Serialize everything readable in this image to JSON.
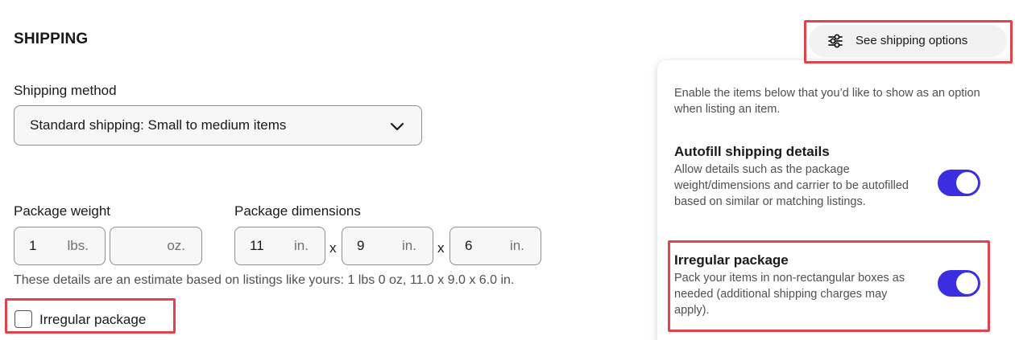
{
  "section_title": "SHIPPING",
  "shipping_method": {
    "label": "Shipping method",
    "selected": "Standard shipping: Small to medium items"
  },
  "package_weight": {
    "label": "Package weight",
    "lbs_value": "1",
    "lbs_unit": "lbs.",
    "oz_value": "",
    "oz_unit": "oz."
  },
  "package_dimensions": {
    "label": "Package dimensions",
    "length_value": "11",
    "width_value": "9",
    "height_value": "6",
    "unit": "in.",
    "separator": "x"
  },
  "estimate_hint": "These details are an estimate based on listings like yours: 1 lbs 0 oz, 11.0 x 9.0 x 6.0 in.",
  "irregular_checkbox": {
    "label": "Irregular package",
    "checked": false
  },
  "shipping_options_button": {
    "label": "See shipping options",
    "icon": "sliders-icon"
  },
  "options_panel": {
    "intro": "Enable the items below that you’d like to show as an option when listing an item.",
    "autofill": {
      "title": "Autofill shipping details",
      "description": "Allow details such as the package weight/dimensions and carrier to be autofilled based on similar or matching listings.",
      "enabled": true
    },
    "irregular": {
      "title": "Irregular package",
      "description": "Pack your items in non-rectangular boxes as needed (additional shipping charges may apply).",
      "enabled": true
    }
  },
  "colors": {
    "toggle_on": "#3a2ee0",
    "highlight_box": "#e0434b"
  }
}
